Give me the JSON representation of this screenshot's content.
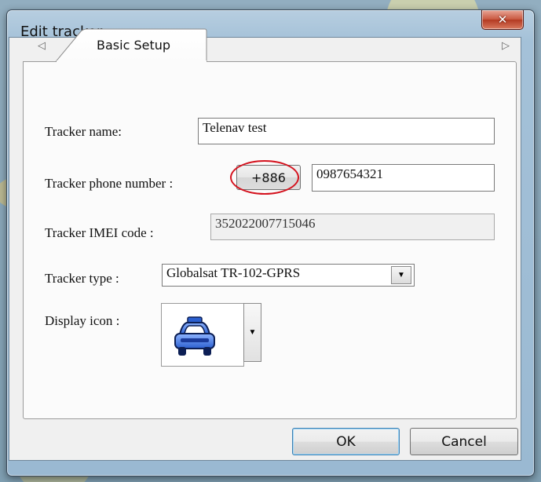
{
  "window": {
    "title": "Edit tracker",
    "close_glyph": "✕"
  },
  "tabs": {
    "active": "Basic Setup",
    "prev_glyph": "◁",
    "next_glyph": "▷"
  },
  "form": {
    "name_label": "Tracker  name:",
    "name_value": "Telenav test",
    "phone_label": "Tracker phone number :",
    "country_code": "+886",
    "phone_value": "0987654321",
    "imei_label": "Tracker IMEI code :",
    "imei_value": "352022007715046",
    "type_label": "Tracker type :",
    "type_value": "Globalsat TR-102-GPRS",
    "icon_label": "Display icon :",
    "icon_name": "taxi-icon"
  },
  "buttons": {
    "ok": "OK",
    "cancel": "Cancel"
  },
  "colors": {
    "highlight": "#d4121e",
    "taxi_body": "#3a6fd8"
  }
}
